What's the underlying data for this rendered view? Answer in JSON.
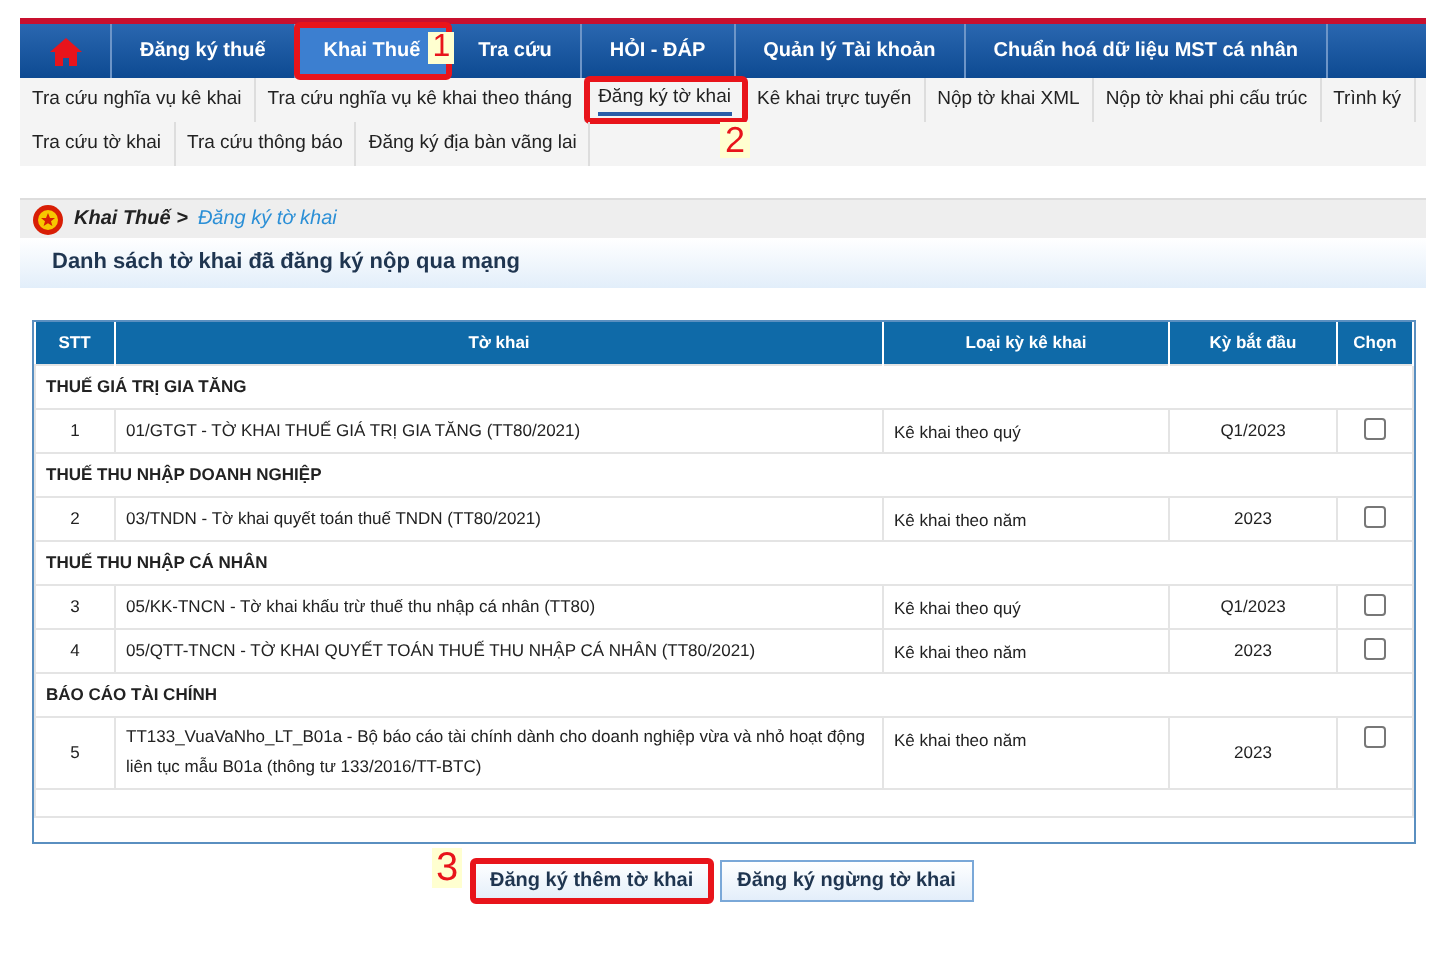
{
  "main_menu": [
    {
      "label": "Đăng ký thuế",
      "selected": false
    },
    {
      "label": "Khai Thuế",
      "selected": true,
      "annotation": "1"
    },
    {
      "label": "Tra cứu",
      "selected": false
    },
    {
      "label": "HỎI - ĐÁP",
      "selected": false
    },
    {
      "label": "Quản lý Tài khoản",
      "selected": false
    },
    {
      "label": "Chuẩn hoá dữ liệu MST cá nhân",
      "selected": false
    }
  ],
  "sub_menu": [
    {
      "label": "Tra cứu nghĩa vụ kê khai",
      "selected": false
    },
    {
      "label": "Tra cứu nghĩa vụ kê khai theo tháng",
      "selected": false
    },
    {
      "label": "Đăng ký tờ khai",
      "selected": true,
      "annotation": "2"
    },
    {
      "label": "Kê khai trực tuyến",
      "selected": false
    },
    {
      "label": "Nộp tờ khai XML",
      "selected": false
    },
    {
      "label": "Nộp tờ khai phi cấu trúc",
      "selected": false
    },
    {
      "label": "Trình ký",
      "selected": false
    },
    {
      "label": "Tra cứu tờ khai",
      "selected": false
    },
    {
      "label": "Tra cứu thông báo",
      "selected": false
    },
    {
      "label": "Đăng ký địa bàn vãng lai",
      "selected": false
    }
  ],
  "breadcrumb": [
    "Khai Thuế >",
    "Đăng ký tờ khai"
  ],
  "section_title": "Danh sách tờ khai đã đăng ký nộp qua mạng",
  "table": {
    "columns": [
      "STT",
      "Tờ khai",
      "Loại kỳ kê khai",
      "Kỳ bắt đầu",
      "Chọn"
    ],
    "rows": [
      {
        "kind": "group",
        "title": "THUẾ GIÁ TRỊ GIA TĂNG"
      },
      {
        "kind": "item",
        "stt": "1",
        "form": "01/GTGT - TỜ KHAI THUẾ GIÁ TRỊ GIA TĂNG (TT80/2021)",
        "period_type": "Kê khai theo quý",
        "start": "Q1/2023",
        "checked": false
      },
      {
        "kind": "group",
        "title": "THUẾ THU NHẬP DOANH NGHIỆP"
      },
      {
        "kind": "item",
        "stt": "2",
        "form": "03/TNDN - Tờ khai quyết toán thuế TNDN (TT80/2021)",
        "period_type": "Kê khai theo năm",
        "start": "2023",
        "checked": false
      },
      {
        "kind": "group",
        "title": "THUẾ THU NHẬP CÁ NHÂN"
      },
      {
        "kind": "item",
        "stt": "3",
        "form": "05/KK-TNCN - Tờ khai khấu trừ thuế thu nhập cá nhân (TT80)",
        "period_type": "Kê khai theo quý",
        "start": "Q1/2023",
        "checked": false
      },
      {
        "kind": "item",
        "stt": "4",
        "form": "05/QTT-TNCN - TỜ KHAI QUYẾT TOÁN THUẾ THU NHẬP CÁ NHÂN (TT80/2021)",
        "period_type": "Kê khai theo năm",
        "start": "2023",
        "checked": false
      },
      {
        "kind": "group",
        "title": "BÁO CÁO TÀI CHÍNH"
      },
      {
        "kind": "item",
        "stt": "5",
        "form": "TT133_VuaVaNho_LT_B01a - Bộ báo cáo tài chính dành cho doanh nghiệp vừa và nhỏ hoạt động liên tục mẫu B01a (thông tư 133/2016/TT-BTC)",
        "period_type": "Kê khai theo năm",
        "start": "2023",
        "checked": false
      }
    ]
  },
  "buttons": [
    {
      "label": "Đăng ký thêm tờ khai",
      "annotation": "3"
    },
    {
      "label": "Đăng ký ngừng tờ khai"
    }
  ]
}
